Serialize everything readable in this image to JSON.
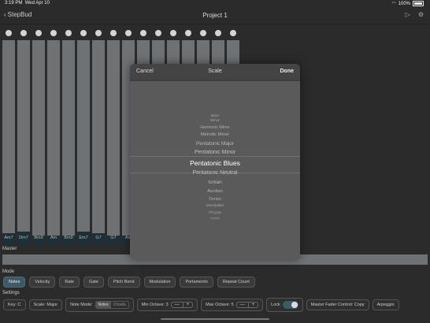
{
  "status": {
    "time": "3:19 PM",
    "date": "Wed Apr 10",
    "wifi": "wifi-icon",
    "battery": "100%"
  },
  "nav": {
    "back_label": "StepBud",
    "title": "Project 1",
    "play_icon": "play-icon",
    "settings_icon": "gear-icon"
  },
  "tracks": [
    "Am7",
    "Dm7",
    "Bm9",
    "Am",
    "Bm9",
    "Em7",
    "G7",
    "G7",
    "Am",
    "",
    "",
    "",
    "",
    "",
    "",
    ""
  ],
  "master_label": "Master",
  "mode": {
    "label": "Mode",
    "buttons": [
      "Notes",
      "Velocity",
      "Rate",
      "Gate",
      "Pitch Bend",
      "Modulation",
      "Portamento",
      "Repeat Count"
    ],
    "selected": "Notes"
  },
  "settings": {
    "label": "Settings",
    "key": "Key: C",
    "scale": "Scale: Major",
    "note_mode_label": "Note Mode:",
    "note_mode_options": [
      "Notes",
      "Chords"
    ],
    "note_mode_selected": "Notes",
    "min_octave": "Min Octave: 3",
    "max_octave": "Max Octave: 5",
    "stepper_minus": "—",
    "stepper_plus": "+",
    "lock": "Lock",
    "lock_on": true,
    "master_fader": "Master Fader Control: Copy",
    "arpeggio": "Arpeggio"
  },
  "modal": {
    "cancel": "Cancel",
    "title": "Scale",
    "done": "Done",
    "options": [
      "Major",
      "Minor",
      "Harmonic Minor",
      "Melodic Minor",
      "Pentatonic Major",
      "Pentatonic Minor",
      "Pentatonic Blues",
      "Pentatonic Neutral",
      "Ionian",
      "Aeolian",
      "Dorian",
      "Mixolydian",
      "Phrygian",
      "Lydian"
    ],
    "selected": "Pentatonic Blues"
  },
  "colors": {
    "accent": "#3d5a66",
    "track": "#6f7275",
    "track_fill": "#1c3036",
    "background": "#2b2b2b"
  }
}
